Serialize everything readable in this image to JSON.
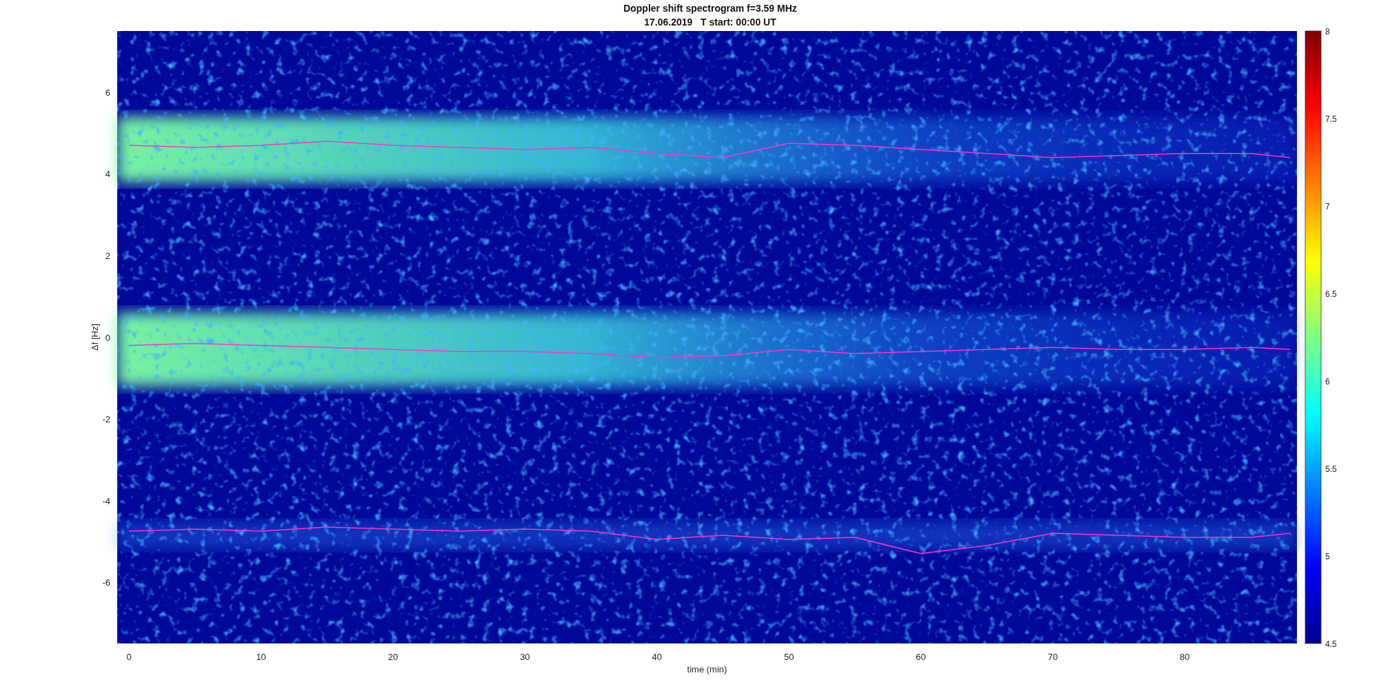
{
  "figure": {
    "title": "Doppler shift spectrogram f=3.59 MHz",
    "subtitle": "17.06.2019   T start: 00:00 UT",
    "chart_data": {
      "type": "line",
      "xlabel": "time (min)",
      "ylabel": "Δf [Hz]",
      "x": [
        0,
        5,
        10,
        15,
        20,
        25,
        30,
        35,
        40,
        45,
        50,
        55,
        60,
        65,
        70,
        75,
        80,
        85,
        88
      ],
      "series": [
        {
          "color": "#ff33cc",
          "values": [
            4.7,
            4.65,
            4.7,
            4.8,
            4.7,
            4.65,
            4.6,
            4.65,
            4.5,
            4.4,
            4.75,
            4.7,
            4.6,
            4.5,
            4.4,
            4.45,
            4.5,
            4.5,
            4.4
          ]
        },
        {
          "color": "#ff33cc",
          "values": [
            -0.2,
            -0.15,
            -0.2,
            -0.25,
            -0.3,
            -0.35,
            -0.35,
            -0.4,
            -0.5,
            -0.45,
            -0.3,
            -0.4,
            -0.35,
            -0.3,
            -0.25,
            -0.3,
            -0.3,
            -0.25,
            -0.3
          ]
        },
        {
          "color": "#ff33cc",
          "values": [
            -4.75,
            -4.7,
            -4.75,
            -4.65,
            -4.7,
            -4.75,
            -4.7,
            -4.75,
            -4.95,
            -4.85,
            -4.95,
            -4.9,
            -5.3,
            -5.1,
            -4.8,
            -4.85,
            -4.9,
            -4.9,
            -4.8
          ]
        }
      ],
      "xlim": [
        -0.9,
        88.5
      ],
      "ylim": [
        -7.5,
        7.5
      ],
      "xticks": [
        0,
        10,
        20,
        30,
        40,
        50,
        60,
        70,
        80
      ],
      "yticks": [
        -6,
        -4,
        -2,
        0,
        2,
        4,
        6
      ]
    },
    "colorbar": {
      "ticks": [
        "8",
        "7.5",
        "7",
        "6.5",
        "6",
        "5.5",
        "5",
        "4.5"
      ]
    }
  }
}
